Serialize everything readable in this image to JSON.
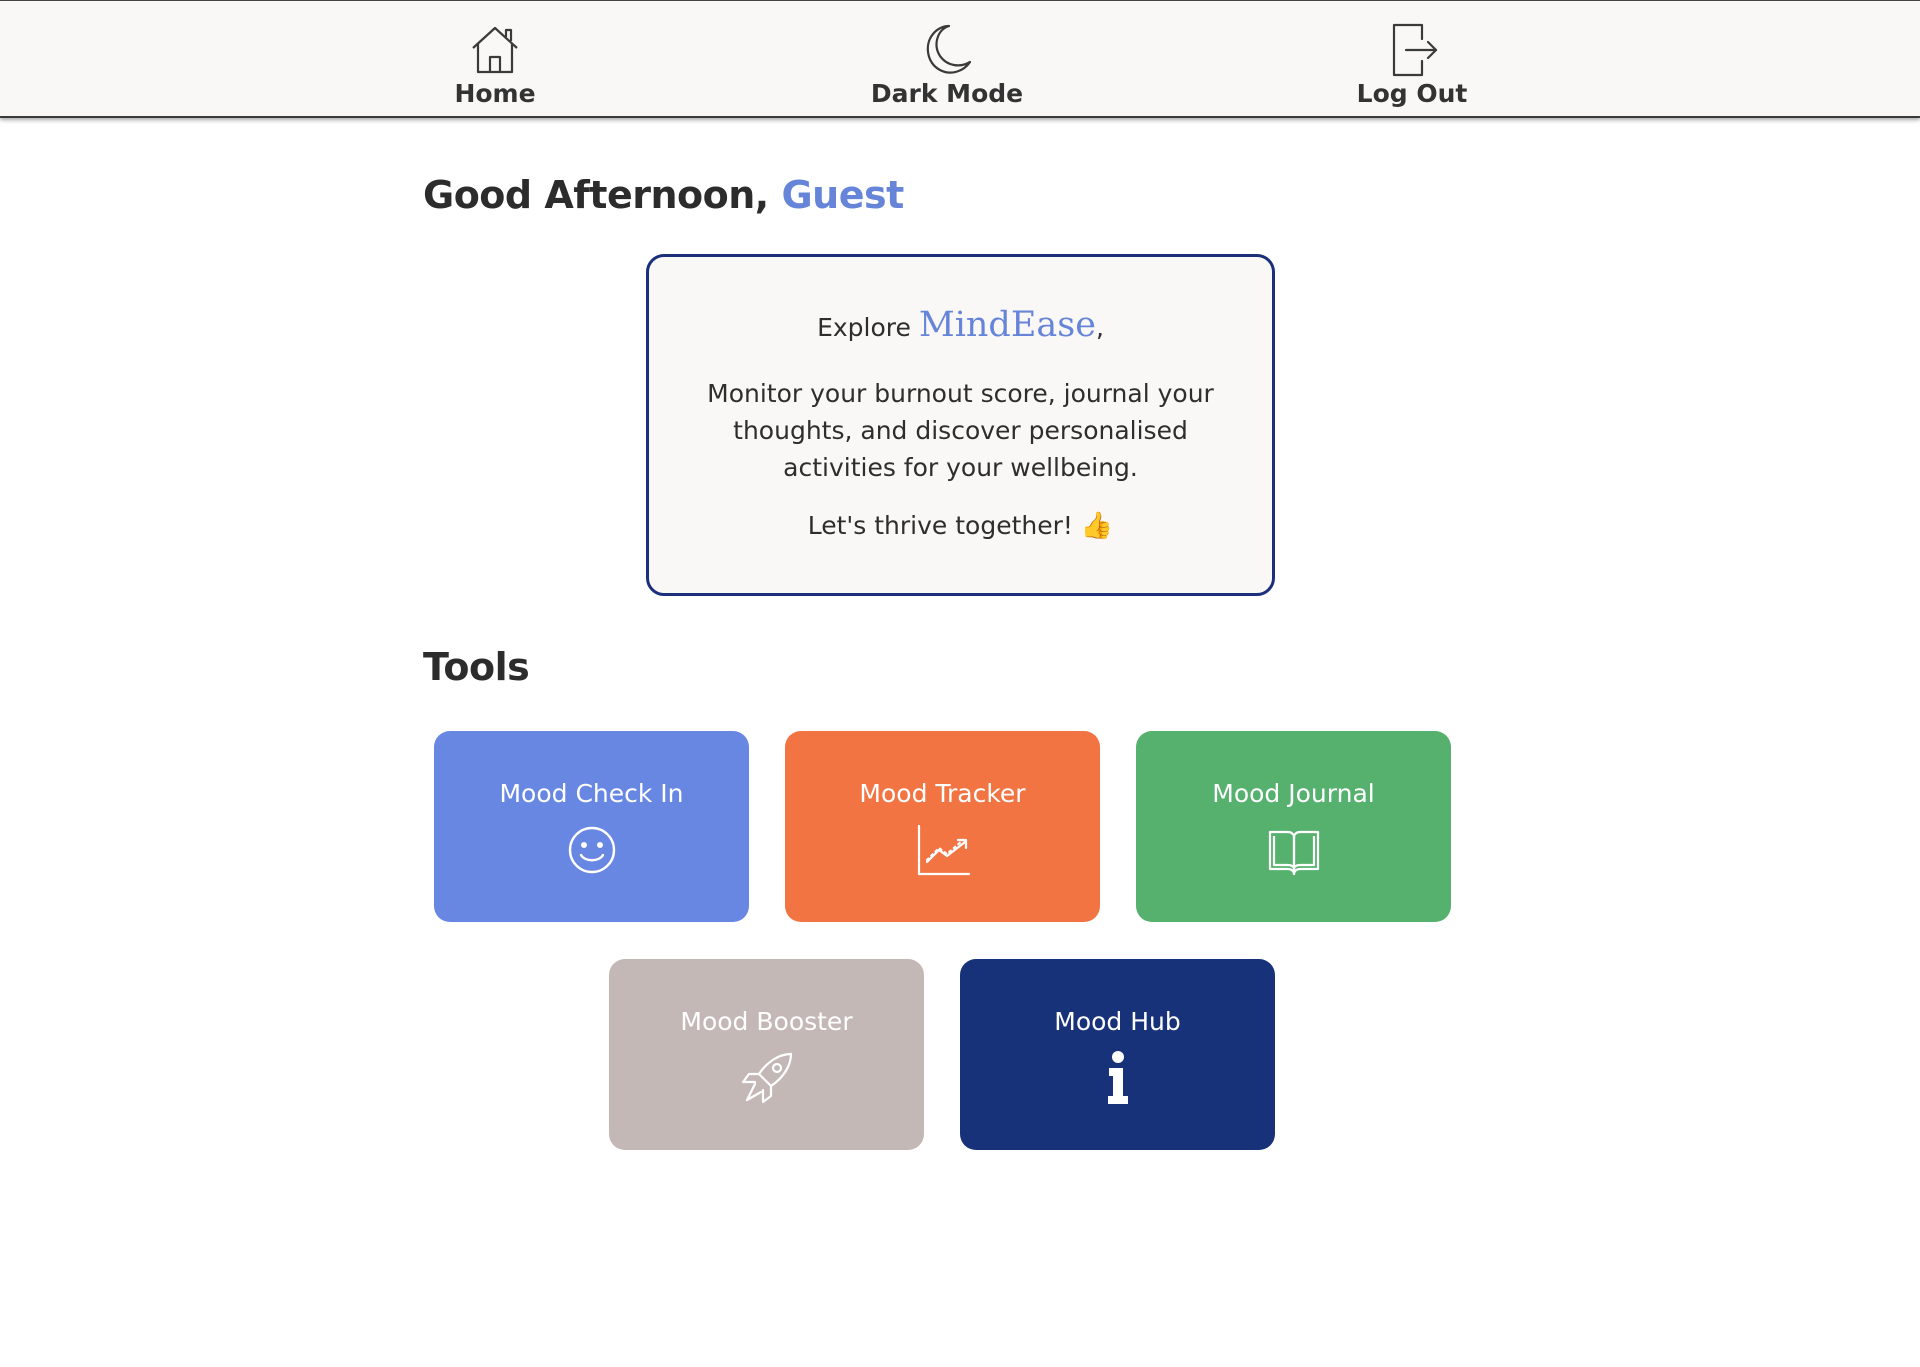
{
  "nav": {
    "items": [
      {
        "label": "Home",
        "icon": "home-icon"
      },
      {
        "label": "Dark Mode",
        "icon": "moon-icon"
      },
      {
        "label": "Log Out",
        "icon": "logout-icon"
      }
    ]
  },
  "greeting": {
    "prefix": "Good Afternoon,",
    "name": "Guest"
  },
  "intro": {
    "explore": "Explore",
    "brand": "MindEase",
    "comma": ",",
    "body": "Monitor your burnout score, journal your thoughts, and discover personalised activities for your wellbeing.",
    "cta": "Let's thrive together!",
    "emoji_icon": "thumbs-up-icon"
  },
  "tools": {
    "heading": "Tools",
    "items": [
      {
        "label": "Mood Check In",
        "icon": "smiley-icon",
        "color": "#6787e3"
      },
      {
        "label": "Mood Tracker",
        "icon": "chart-icon",
        "color": "#f37443"
      },
      {
        "label": "Mood Journal",
        "icon": "book-icon",
        "color": "#56b16e"
      },
      {
        "label": "Mood Booster",
        "icon": "rocket-icon",
        "color": "#c4b8b7"
      },
      {
        "label": "Mood Hub",
        "icon": "info-icon",
        "color": "#18327a"
      }
    ]
  },
  "colors": {
    "accent": "#6685d9",
    "card_border": "#1b2f7a"
  }
}
